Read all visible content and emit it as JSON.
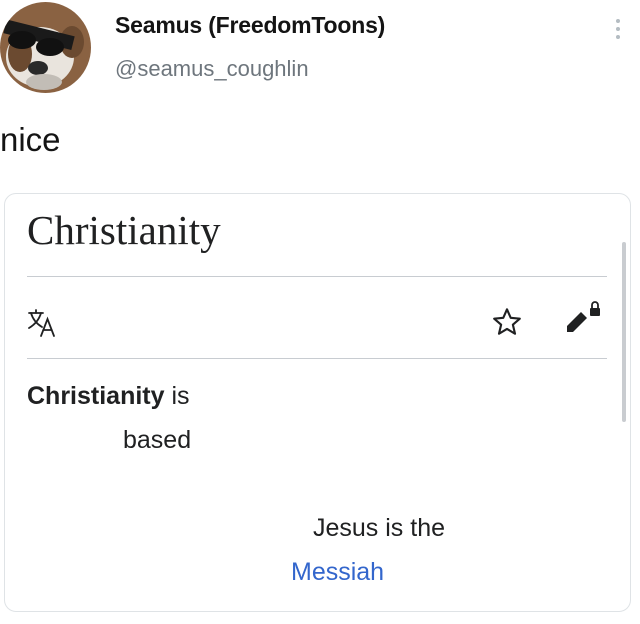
{
  "tweet": {
    "display_name": "Seamus (FreedomToons)",
    "handle": "@seamus_coughlin",
    "text": "nice",
    "avatar_icon": "dog-with-sunglasses-avatar",
    "more_icon": "vertical-ellipsis-icon"
  },
  "wiki_card": {
    "title": "Christianity",
    "toolbar": {
      "translate_icon": "translate-icon",
      "watch_icon": "star-icon",
      "edit_icon": "edit-locked-icon"
    },
    "body": {
      "lead_bold": "Christianity",
      "lead_rest": " is",
      "line2": "based",
      "line3": "Jesus is the",
      "link": "Messiah"
    },
    "colors": {
      "link": "#3366cc",
      "rule": "#c8ccd1",
      "icon": "#202122"
    }
  }
}
